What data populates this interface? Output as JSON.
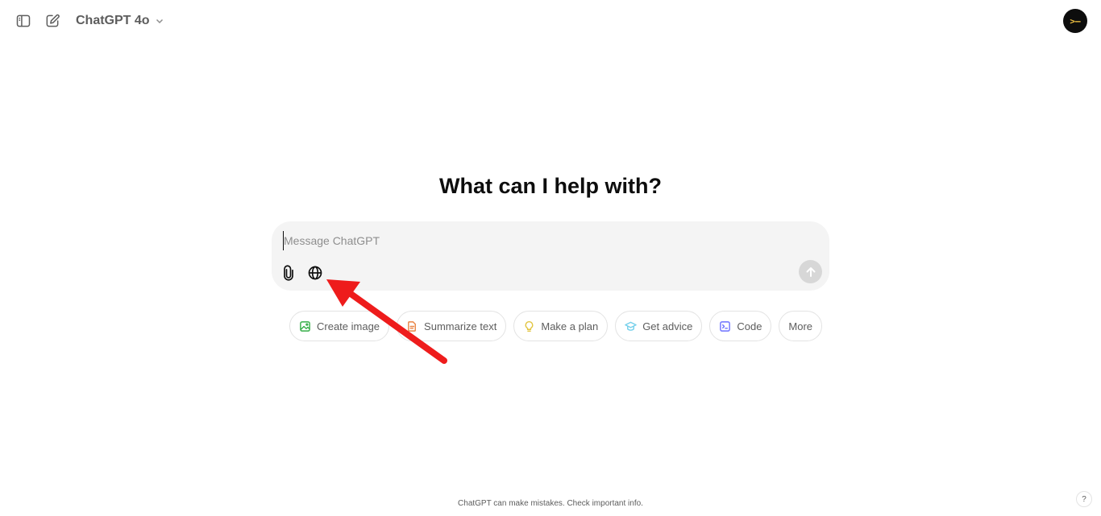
{
  "header": {
    "sidebar_toggle_icon": "sidebar-toggle-icon",
    "new_chat_icon": "new-chat-icon",
    "model_name": "ChatGPT 4o",
    "avatar_text": ">–"
  },
  "main": {
    "title": "What can I help with?",
    "composer": {
      "placeholder": "Message ChatGPT",
      "value": "",
      "attach_icon": "paperclip-icon",
      "search_icon": "globe-icon",
      "send_icon": "arrow-up-icon"
    },
    "suggestions": [
      {
        "label": "Create image",
        "icon": "image-icon",
        "color": "#35ae47"
      },
      {
        "label": "Summarize text",
        "icon": "document-icon",
        "color": "#ea8444"
      },
      {
        "label": "Make a plan",
        "icon": "lightbulb-icon",
        "color": "#e2c541"
      },
      {
        "label": "Get advice",
        "icon": "graduation-cap-icon",
        "color": "#76d0eb"
      },
      {
        "label": "Code",
        "icon": "terminal-icon",
        "color": "#6c71ff"
      },
      {
        "label": "More",
        "icon": "",
        "color": ""
      }
    ]
  },
  "footer": {
    "disclaimer": "ChatGPT can make mistakes. Check important info.",
    "help_label": "?"
  },
  "annotation": {
    "color": "#ee1c1c"
  }
}
